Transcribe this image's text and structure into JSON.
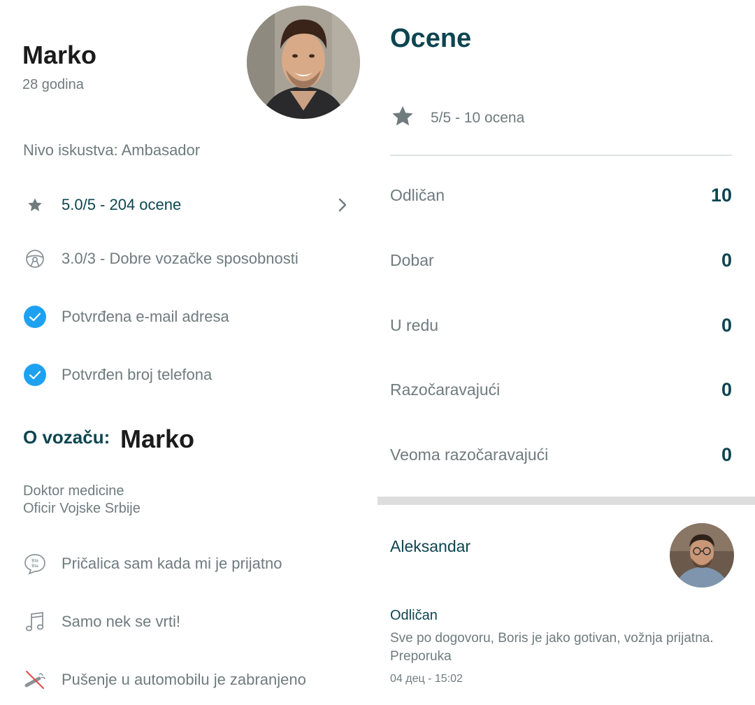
{
  "profile": {
    "name": "Marko",
    "age": "28 godina",
    "level": "Nivo iskustva:  Ambasador"
  },
  "stats": {
    "rating": "5.0/5 - 204 ocene",
    "driving": "3.0/3 - Dobre vozačke sposobnosti",
    "email": "Potvrđena e-mail adresa",
    "phone": "Potvrđen broj telefona"
  },
  "about": {
    "title": "O vozaču:",
    "name": "Marko",
    "lines": [
      "Doktor medicine",
      "Oficir Vojske Srbije"
    ]
  },
  "prefs": {
    "chat": "Pričalica sam kada mi je prijatno",
    "music": "Samo nek se vrti!",
    "smoking": "Pušenje u automobilu je zabranjeno"
  },
  "ratings": {
    "title": "Ocene",
    "summary": "5/5 - 10 ocena",
    "breakdown": [
      {
        "label": "Odličan",
        "count": "10"
      },
      {
        "label": "Dobar",
        "count": "0"
      },
      {
        "label": "U redu",
        "count": "0"
      },
      {
        "label": "Razočaravajući",
        "count": "0"
      },
      {
        "label": "Veoma razočaravajući",
        "count": "0"
      }
    ]
  },
  "review": {
    "author": "Aleksandar",
    "rating": "Odličan",
    "text": "Sve po dogovoru, Boris je jako gotivan, vožnja prijatna. Preporuka",
    "date": "04 дец - 15:02"
  },
  "colors": {
    "primary": "#0d4550",
    "muted": "#6f7b7d",
    "verified": "#1ea1f1",
    "icon": "#6f7b7d"
  },
  "icons": {
    "star": "star-icon",
    "steering": "steering-wheel-icon",
    "check": "check-circle-icon",
    "chevron": "chevron-right-icon",
    "chat": "blabla-chat-icon",
    "music": "music-note-icon",
    "smoking": "no-smoking-icon"
  }
}
